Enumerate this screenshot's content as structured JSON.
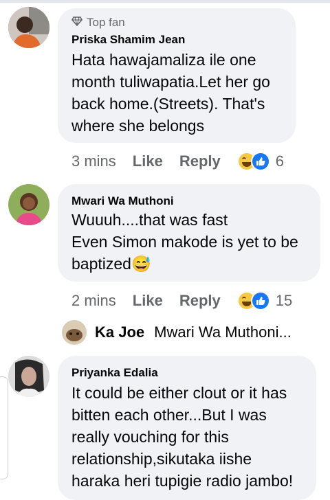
{
  "comments": [
    {
      "badge": "Top fan",
      "author": "Priska Shamim Jean",
      "lines": [
        "Hata hawajamaliza ile one",
        "month tuliwapatia.Let her go",
        "back home.(Streets). That's",
        "where she belongs"
      ],
      "time": "3 mins",
      "like": "Like",
      "reply": "Reply",
      "reactions": "6"
    },
    {
      "author": "Mwari Wa Muthoni",
      "lines": [
        "Wuuuh....that was fast",
        "Even Simon makode is yet to be",
        "baptized😅"
      ],
      "time": "2 mins",
      "like": "Like",
      "reply": "Reply",
      "reactions": "15"
    },
    {
      "author": "Priyanka Edalia",
      "lines": [
        "It could be either clout or it has",
        "bitten each other...But I was",
        "really vouching for this",
        "relationship,sikutaka iishe",
        "haraka heri tupigie radio jambo!"
      ]
    }
  ],
  "reply_preview": {
    "author": "Ka Joe",
    "text": "Mwari Wa Muthoni..."
  }
}
